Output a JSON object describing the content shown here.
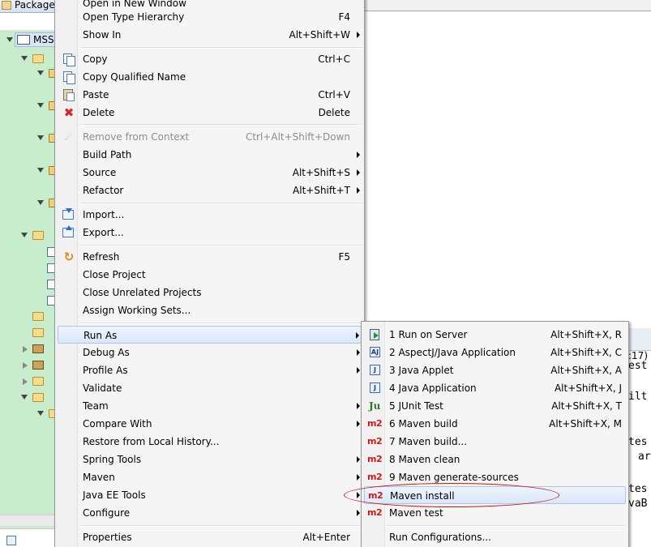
{
  "explorer": {
    "tab_title": "Package",
    "project_label": "MSS"
  },
  "editor": {
    "line_number_fragment": ":17)",
    "code_fragments": [
      "est",
      "ilt",
      "tes",
      "ar",
      "tes",
      "vaB"
    ]
  },
  "context_menu": {
    "items": [
      {
        "label": "Open in New Window",
        "accel": "",
        "submenu": false,
        "disabled": false,
        "icon": ""
      },
      {
        "label": "Open Type Hierarchy",
        "accel": "F4",
        "submenu": false,
        "disabled": false,
        "icon": ""
      },
      {
        "label": "Show In",
        "accel": "Alt+Shift+W",
        "submenu": true,
        "disabled": false,
        "icon": ""
      },
      {
        "label": "Copy",
        "accel": "Ctrl+C",
        "submenu": false,
        "disabled": false,
        "icon": "copy-icon"
      },
      {
        "label": "Copy Qualified Name",
        "accel": "",
        "submenu": false,
        "disabled": false,
        "icon": "copy-qualified-name-icon"
      },
      {
        "label": "Paste",
        "accel": "Ctrl+V",
        "submenu": false,
        "disabled": false,
        "icon": "paste-icon"
      },
      {
        "label": "Delete",
        "accel": "Delete",
        "submenu": false,
        "disabled": false,
        "icon": "delete-icon"
      },
      {
        "label": "Remove from Context",
        "accel": "Ctrl+Alt+Shift+Down",
        "submenu": false,
        "disabled": true,
        "icon": "remove-context-icon"
      },
      {
        "label": "Build Path",
        "accel": "",
        "submenu": true,
        "disabled": false,
        "icon": ""
      },
      {
        "label": "Source",
        "accel": "Alt+Shift+S",
        "submenu": true,
        "disabled": false,
        "icon": ""
      },
      {
        "label": "Refactor",
        "accel": "Alt+Shift+T",
        "submenu": true,
        "disabled": false,
        "icon": ""
      },
      {
        "label": "Import...",
        "accel": "",
        "submenu": false,
        "disabled": false,
        "icon": "import-icon"
      },
      {
        "label": "Export...",
        "accel": "",
        "submenu": false,
        "disabled": false,
        "icon": "export-icon"
      },
      {
        "label": "Refresh",
        "accel": "F5",
        "submenu": false,
        "disabled": false,
        "icon": "refresh-icon"
      },
      {
        "label": "Close Project",
        "accel": "",
        "submenu": false,
        "disabled": false,
        "icon": ""
      },
      {
        "label": "Close Unrelated Projects",
        "accel": "",
        "submenu": false,
        "disabled": false,
        "icon": ""
      },
      {
        "label": "Assign Working Sets...",
        "accel": "",
        "submenu": false,
        "disabled": false,
        "icon": ""
      },
      {
        "label": "Run As",
        "accel": "",
        "submenu": true,
        "disabled": false,
        "icon": "",
        "highlighted": true
      },
      {
        "label": "Debug As",
        "accel": "",
        "submenu": true,
        "disabled": false,
        "icon": ""
      },
      {
        "label": "Profile As",
        "accel": "",
        "submenu": true,
        "disabled": false,
        "icon": ""
      },
      {
        "label": "Validate",
        "accel": "",
        "submenu": false,
        "disabled": false,
        "icon": ""
      },
      {
        "label": "Team",
        "accel": "",
        "submenu": true,
        "disabled": false,
        "icon": ""
      },
      {
        "label": "Compare With",
        "accel": "",
        "submenu": true,
        "disabled": false,
        "icon": ""
      },
      {
        "label": "Restore from Local History...",
        "accel": "",
        "submenu": false,
        "disabled": false,
        "icon": ""
      },
      {
        "label": "Spring Tools",
        "accel": "",
        "submenu": true,
        "disabled": false,
        "icon": ""
      },
      {
        "label": "Maven",
        "accel": "",
        "submenu": true,
        "disabled": false,
        "icon": ""
      },
      {
        "label": "Java EE Tools",
        "accel": "",
        "submenu": true,
        "disabled": false,
        "icon": ""
      },
      {
        "label": "Configure",
        "accel": "",
        "submenu": true,
        "disabled": false,
        "icon": ""
      },
      {
        "label": "Properties",
        "accel": "Alt+Enter",
        "submenu": false,
        "disabled": false,
        "icon": ""
      }
    ]
  },
  "run_as_submenu": {
    "items": [
      {
        "label": "1 Run on Server",
        "accel": "Alt+Shift+X, R",
        "icon": "run-on-server-icon"
      },
      {
        "label": "2 AspectJ/Java Application",
        "accel": "Alt+Shift+X, C",
        "icon": "aspectj-application-icon"
      },
      {
        "label": "3 Java Applet",
        "accel": "Alt+Shift+X, A",
        "icon": "java-applet-icon"
      },
      {
        "label": "4 Java Application",
        "accel": "Alt+Shift+X, J",
        "icon": "java-application-icon"
      },
      {
        "label": "5 JUnit Test",
        "accel": "Alt+Shift+X, T",
        "icon": "junit-icon"
      },
      {
        "label": "6 Maven build",
        "accel": "Alt+Shift+X, M",
        "icon": "maven-m2-icon"
      },
      {
        "label": "7 Maven build...",
        "accel": "",
        "icon": "maven-m2-icon"
      },
      {
        "label": "8 Maven clean",
        "accel": "",
        "icon": "maven-m2-icon"
      },
      {
        "label": "9 Maven generate-sources",
        "accel": "",
        "icon": "maven-m2-icon"
      },
      {
        "label": "Maven install",
        "accel": "",
        "icon": "maven-m2-icon",
        "highlighted": true
      },
      {
        "label": "Maven test",
        "accel": "",
        "icon": "maven-m2-icon"
      },
      {
        "label": "Run Configurations...",
        "accel": "",
        "icon": ""
      }
    ],
    "m2_text": "m2",
    "junit_text": "Ju",
    "aspectj_text": "AJ",
    "java_text": "J"
  }
}
